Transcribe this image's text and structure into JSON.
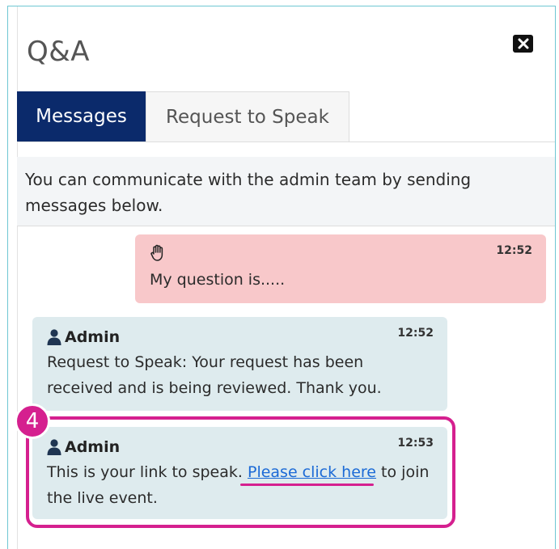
{
  "panel": {
    "title": "Q&A"
  },
  "tabs": [
    {
      "label": "Messages",
      "active": true
    },
    {
      "label": "Request to Speak",
      "active": false
    }
  ],
  "info": {
    "text": "You can communicate with the admin team by sending messages below."
  },
  "messages": [
    {
      "type": "user",
      "icon": "raised-hand-icon",
      "time": "12:52",
      "text": "My question is....."
    },
    {
      "type": "admin",
      "sender": "Admin",
      "icon": "user-icon",
      "time": "12:52",
      "text": "Request to Speak: Your request has been received and is being reviewed. Thank you."
    },
    {
      "type": "admin",
      "sender": "Admin",
      "icon": "user-icon",
      "time": "12:53",
      "text_before": "This is your link to speak.",
      "link": "Please click here",
      "text_after": "to join the live event."
    }
  ],
  "annotation": {
    "step": "4"
  },
  "colors": {
    "accent_tab": "#0b2a6b",
    "user_bubble": "#f8c8ca",
    "admin_bubble": "#deebee",
    "highlight": "#d5208f",
    "link": "#1b6ad6"
  }
}
